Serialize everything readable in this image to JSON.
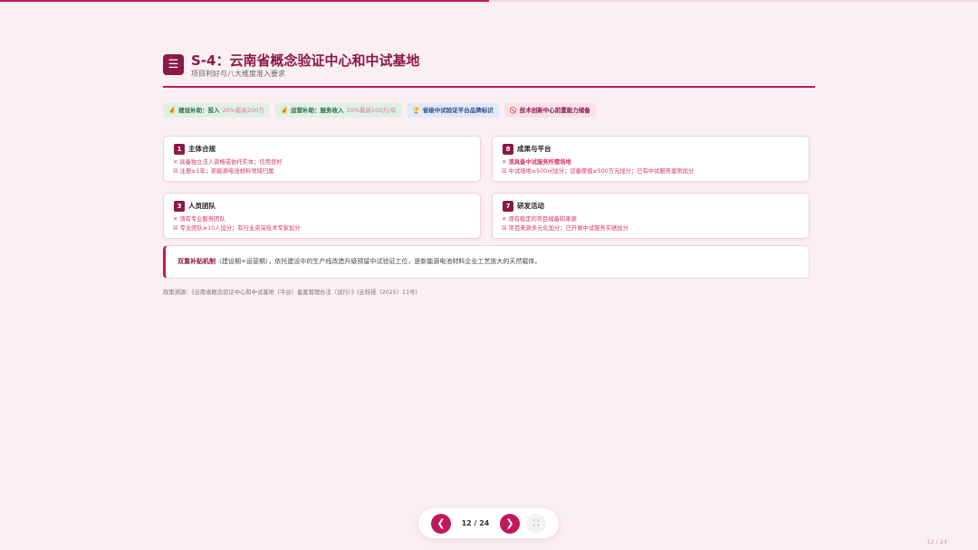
{
  "progress": {
    "fraction": 0.5,
    "color": "#c2185b"
  },
  "header": {
    "menu_icon": "menu-icon",
    "menu_glyph": "☰",
    "title": "S-4：云南省概念验证中心和中试基地",
    "subtitle": "项目利好与八大维度准入要求"
  },
  "tags": [
    {
      "icon": "💰",
      "label": "建设补助：投入",
      "detail": "20%最高200万"
    },
    {
      "icon": "💰",
      "label": "运营补助：服务收入",
      "detail": "20%最高100万/年"
    },
    {
      "icon": "🏆",
      "label": "省级中试验证平台品牌标识"
    },
    {
      "icon": "🚫",
      "label": "技术创新中心前置能力储备"
    }
  ],
  "cards": [
    {
      "num": "1",
      "title": "主体合规",
      "line1": "✕ 具备独立法人资格或依托实体；信用良好",
      "line2": "☒ 注册≥1年；新能源电池材料领域归属"
    },
    {
      "num": "8",
      "title": "成果与平台",
      "line1": "✕ 须具备中试服务所需场地",
      "line2": "☒ 中试场地≥500㎡加分；设备原值≥500万元加分；已有中试服务案例加分"
    },
    {
      "num": "3",
      "title": "人员团队",
      "line1": "✕ 须有专业服务团队",
      "line2": "☒ 专业团队≥10人加分；有行业资深技术专家加分"
    },
    {
      "num": "7",
      "title": "研发活动",
      "line1": "✕ 须有稳定的项目储备和来源",
      "line2": "☒ 项目来源多元化加分；已开展中试服务实绩加分"
    }
  ],
  "callout": {
    "bold": "双重补贴机制",
    "text": "（建设期+运营期），依托建设中的生产线改造升级预留中试验证工位，是新能源电池材料企业工艺放大的天然载体。"
  },
  "source": "政策溯源：《云南省概念验证中心和中试基地（平台）备案管理办法（试行）》(云科规〔2025〕11号)",
  "pager": {
    "prev_glyph": "❮",
    "next_glyph": "❯",
    "fullscreen_glyph": "⛶",
    "text": "12 / 24"
  },
  "corner": "12 / 24"
}
